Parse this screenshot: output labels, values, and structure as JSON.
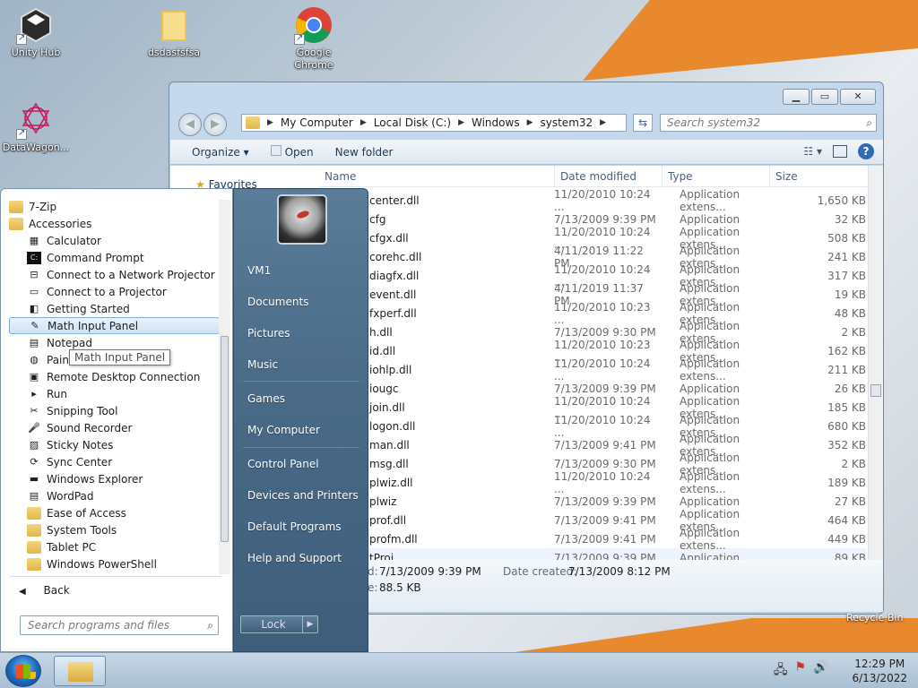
{
  "desktop": {
    "icons": [
      {
        "label": "Unity Hub"
      },
      {
        "label": "dsdasfsfsa"
      },
      {
        "label": "Google Chrome"
      },
      {
        "label": "DataWagon..."
      }
    ],
    "recycle_bin": "Recycle Bin"
  },
  "explorer": {
    "breadcrumb": [
      "My Computer",
      "Local Disk (C:)",
      "Windows",
      "system32"
    ],
    "search_placeholder": "Search system32",
    "toolbar": {
      "organize": "Organize ▾",
      "open": "Open",
      "new_folder": "New folder"
    },
    "columns": {
      "name": "Name",
      "date": "Date modified",
      "type": "Type",
      "size": "Size"
    },
    "sidebar": {
      "favorites": "Favorites"
    },
    "files": [
      {
        "name": "center.dll",
        "date": "11/20/2010 10:24 ...",
        "type": "Application extens...",
        "size": "1,650 KB"
      },
      {
        "name": "cfg",
        "date": "7/13/2009 9:39 PM",
        "type": "Application",
        "size": "32 KB"
      },
      {
        "name": "cfgx.dll",
        "date": "11/20/2010 10:24 ...",
        "type": "Application extens...",
        "size": "508 KB"
      },
      {
        "name": "corehc.dll",
        "date": "4/11/2019 11:22 PM",
        "type": "Application extens...",
        "size": "241 KB"
      },
      {
        "name": "diagfx.dll",
        "date": "11/20/2010 10:24 ...",
        "type": "Application extens...",
        "size": "317 KB"
      },
      {
        "name": "event.dll",
        "date": "4/11/2019 11:37 PM",
        "type": "Application extens...",
        "size": "19 KB"
      },
      {
        "name": "fxperf.dll",
        "date": "11/20/2010 10:23 ...",
        "type": "Application extens...",
        "size": "48 KB"
      },
      {
        "name": "h.dll",
        "date": "7/13/2009 9:30 PM",
        "type": "Application extens...",
        "size": "2 KB"
      },
      {
        "name": "id.dll",
        "date": "11/20/2010 10:23 ...",
        "type": "Application extens...",
        "size": "162 KB"
      },
      {
        "name": "iohlp.dll",
        "date": "11/20/2010 10:24 ...",
        "type": "Application extens...",
        "size": "211 KB"
      },
      {
        "name": "iougc",
        "date": "7/13/2009 9:39 PM",
        "type": "Application",
        "size": "26 KB"
      },
      {
        "name": "join.dll",
        "date": "11/20/2010 10:24 ...",
        "type": "Application extens...",
        "size": "185 KB"
      },
      {
        "name": "logon.dll",
        "date": "11/20/2010 10:24 ...",
        "type": "Application extens...",
        "size": "680 KB"
      },
      {
        "name": "man.dll",
        "date": "7/13/2009 9:41 PM",
        "type": "Application extens...",
        "size": "352 KB"
      },
      {
        "name": "msg.dll",
        "date": "7/13/2009 9:30 PM",
        "type": "Application extens...",
        "size": "2 KB"
      },
      {
        "name": "plwiz.dll",
        "date": "11/20/2010 10:24 ...",
        "type": "Application extens...",
        "size": "189 KB"
      },
      {
        "name": "plwiz",
        "date": "7/13/2009 9:39 PM",
        "type": "Application",
        "size": "27 KB"
      },
      {
        "name": "prof.dll",
        "date": "7/13/2009 9:41 PM",
        "type": "Application extens...",
        "size": "464 KB"
      },
      {
        "name": "profm.dll",
        "date": "7/13/2009 9:41 PM",
        "type": "Application extens...",
        "size": "449 KB"
      },
      {
        "name": "tProj",
        "date": "7/13/2009 9:39 PM",
        "type": "Application",
        "size": "89 KB"
      }
    ],
    "details": {
      "modified_label": "d:",
      "modified": "7/13/2009 9:39 PM",
      "created_label": "Date created:",
      "created": "7/13/2009 8:12 PM",
      "size_label": "e:",
      "size": "88.5 KB"
    }
  },
  "start_menu": {
    "programs": [
      {
        "label": "7-Zip",
        "icon": "folder-icon",
        "level": 0
      },
      {
        "label": "Accessories",
        "icon": "folder-icon",
        "level": 0
      },
      {
        "label": "Calculator",
        "icon": "calculator-icon",
        "level": 1
      },
      {
        "label": "Command Prompt",
        "icon": "cmd-icon",
        "level": 1
      },
      {
        "label": "Connect to a Network Projector",
        "icon": "network-projector-icon",
        "level": 1
      },
      {
        "label": "Connect to a Projector",
        "icon": "projector-icon",
        "level": 1
      },
      {
        "label": "Getting Started",
        "icon": "getting-started-icon",
        "level": 1
      },
      {
        "label": "Math Input Panel",
        "icon": "math-input-icon",
        "level": 1,
        "highlighted": true
      },
      {
        "label": "Notepad",
        "icon": "notepad-icon",
        "level": 1
      },
      {
        "label": "Paint",
        "icon": "paint-icon",
        "level": 1
      },
      {
        "label": "Remote Desktop Connection",
        "icon": "remote-desktop-icon",
        "level": 1
      },
      {
        "label": "Run",
        "icon": "run-icon",
        "level": 1
      },
      {
        "label": "Snipping Tool",
        "icon": "snipping-icon",
        "level": 1
      },
      {
        "label": "Sound Recorder",
        "icon": "microphone-icon",
        "level": 1
      },
      {
        "label": "Sticky Notes",
        "icon": "sticky-notes-icon",
        "level": 1
      },
      {
        "label": "Sync Center",
        "icon": "sync-icon",
        "level": 1
      },
      {
        "label": "Windows Explorer",
        "icon": "explorer-icon",
        "level": 1
      },
      {
        "label": "WordPad",
        "icon": "wordpad-icon",
        "level": 1
      },
      {
        "label": "Ease of Access",
        "icon": "folder-icon",
        "level": 1
      },
      {
        "label": "System Tools",
        "icon": "folder-icon",
        "level": 1
      },
      {
        "label": "Tablet PC",
        "icon": "folder-icon",
        "level": 1
      },
      {
        "label": "Windows PowerShell",
        "icon": "folder-icon",
        "level": 1
      }
    ],
    "tooltip": "Math Input Panel",
    "back": "Back",
    "search_placeholder": "Search programs and files",
    "right": [
      "VM1",
      "Documents",
      "Pictures",
      "Music",
      "Games",
      "My Computer",
      "Control Panel",
      "Devices and Printers",
      "Default Programs",
      "Help and Support"
    ],
    "lock": "Lock"
  },
  "taskbar": {
    "time": "12:29 PM",
    "date": "6/13/2022"
  }
}
